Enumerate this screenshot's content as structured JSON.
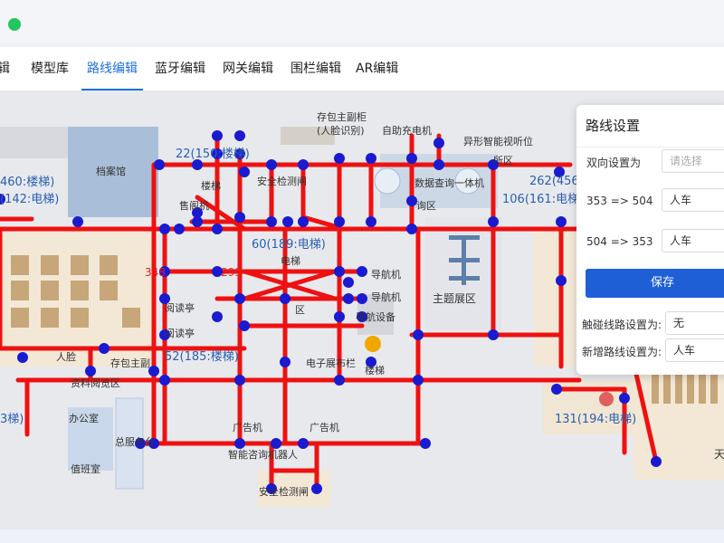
{
  "tabs": [
    {
      "label": "辑"
    },
    {
      "label": "模型库"
    },
    {
      "label": "路线编辑",
      "active": true
    },
    {
      "label": "蓝牙编辑"
    },
    {
      "label": "网关编辑"
    },
    {
      "label": "围栏编辑"
    },
    {
      "label": "AR编辑"
    }
  ],
  "map": {
    "route_color": "#ee1111",
    "node_color": "#1a1ad0",
    "labels": {
      "storage": "存包主副柜",
      "face_id": "(人脸识别)",
      "auto_charge": "自助充电机",
      "smart_video": "异形智能视听位",
      "archive": "档案馆",
      "elevator_460": "460:楼梯)",
      "elevator_142": "(142:电梯)",
      "elevator_22": "22(150:楼梯)",
      "stairs_a": "楼梯",
      "security_gate": "安全检测闸",
      "xian_qu": "所区",
      "data_query": "数据查询一体机",
      "zone_qu": "询区",
      "elevator_262": "262(456",
      "elevator_106": "106(161:电梯",
      "ticket": "售阁机",
      "elevator_60": "60(189:电梯)",
      "elevator_label": "电梯",
      "node_348": "348",
      "node_299": "299",
      "guide_a": "导航机",
      "guide_b": "导航机",
      "theme": "主题展区",
      "reading_a": "阅读亭",
      "reading_b": "阅读亭",
      "zone_qu2": "区",
      "guide_device": "导航设备",
      "elevator_52": "52(185:楼梯)",
      "ren_lian": "人脸",
      "cun_bao": "存包主副",
      "e_board": "电子展布栏",
      "stairs_b": "楼梯",
      "archive_room": "资料阅览区",
      "office": "办公室",
      "general_service": "总服务台",
      "duty": "值班室",
      "ad_a": "广告机",
      "ad_b": "广告机",
      "smart_consult": "智能咨询机器人",
      "security_gate_b": "安全检测闸",
      "elevator_131": "131(194:电梯)",
      "elevator_left_bottom": "3梯)",
      "tian": "天"
    }
  },
  "panel": {
    "title": "路线设置",
    "bidirectional_label": "双向设置为",
    "bidirectional_placeholder": "请选择",
    "route_a_label": "353 => 504",
    "route_a_value": "人车",
    "route_b_label": "504 => 353",
    "route_b_value": "人车",
    "save_label": "保存",
    "collision_label": "触碰线路设置为:",
    "collision_value": "无",
    "new_route_label": "新增路线设置为:",
    "new_route_value": "人车"
  }
}
